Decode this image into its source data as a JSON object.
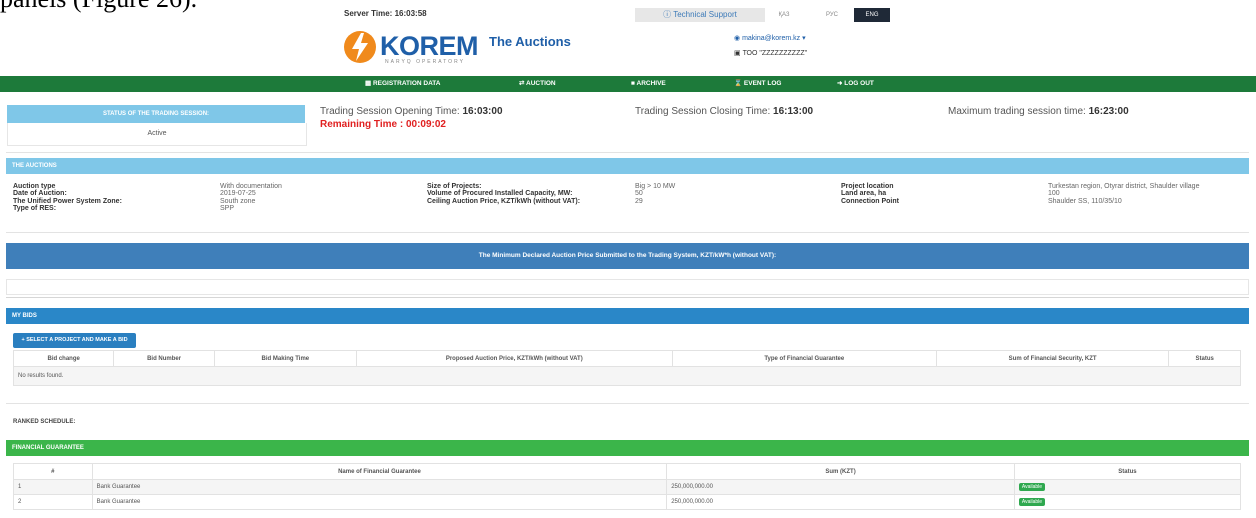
{
  "caption": "panels (Figure 26).",
  "header": {
    "server_time_label": "Server Time:",
    "server_time": "16:03:58",
    "tech_support": "Technical Support",
    "languages": [
      "ҚАЗ",
      "РУС",
      "ENG"
    ],
    "active_language": "ENG",
    "logo_text": "KOREM",
    "logo_sub": "NARYQ OPERATORY",
    "page_title": "The Auctions",
    "user_email": "makina@korem.kz",
    "company": "ТОО \"ZZZZZZZZZZ\""
  },
  "nav": {
    "items": [
      "REGISTRATION DATA",
      "AUCTION",
      "ARCHIVE",
      "EVENT LOG",
      "LOG OUT"
    ]
  },
  "session": {
    "status_heading": "STATUS OF THE TRADING SESSION:",
    "status_value": "Active",
    "opening_label": "Trading Session Opening Time:",
    "opening_time": "16:03:00",
    "closing_label": "Trading Session Closing Time:",
    "closing_time": "16:13:00",
    "max_label": "Maximum trading session time:",
    "max_time": "16:23:00",
    "remaining_label": "Remaining Time :",
    "remaining_time": "00:09:02"
  },
  "auctions": {
    "heading": "THE AUCTIONS",
    "col1_keys": [
      "Auction type",
      "Date of Auction:",
      "The Unified Power System Zone:",
      "Type of RES:"
    ],
    "col1_vals": [
      "With documentation",
      "2019-07-25",
      "South zone",
      "SPP"
    ],
    "col2_keys": [
      "Size of Projects:",
      "Volume of Procured Installed Capacity, MW:",
      "Ceiling Auction Price, KZT/kWh (without VAT):"
    ],
    "col2_vals": [
      "Big > 10 MW",
      "50",
      "29"
    ],
    "col3_keys": [
      "Project location",
      "Land area, ha",
      "Connection Point"
    ],
    "col3_vals": [
      "Turkestan region, Otyrar district, Shaulder village",
      "100",
      "Shaulder SS, 110/35/10"
    ]
  },
  "min_price_bar": "The Minimum Declared Auction Price Submitted to the Trading System, KZT/kW*h (without VAT):",
  "bids": {
    "heading": "MY BIDS",
    "button": "+ SELECT A PROJECT AND MAKE A BID",
    "columns": [
      "Bid change",
      "Bid Number",
      "Bid Making Time",
      "Proposed Auction Price, KZT/kWh (without VAT)",
      "Type of Financial Guarantee",
      "Sum of Financial Security, KZT",
      "Status"
    ],
    "empty": "No results found."
  },
  "ranked_schedule": "RANKED SCHEDULE:",
  "guarantee": {
    "heading": "FINANCIAL GUARANTEE",
    "columns": [
      "#",
      "Name of Financial Guarantee",
      "Sum (KZT)",
      "Status"
    ],
    "rows": [
      {
        "num": "1",
        "name": "Bank Guarantee",
        "sum": "250,000,000.00",
        "status": "Available"
      },
      {
        "num": "2",
        "name": "Bank Guarantee",
        "sum": "250,000,000.00",
        "status": "Available"
      }
    ]
  },
  "colors": {
    "nav": "#1d7a3a",
    "light_blue": "#7fc7e8",
    "blue_bar": "#3f7fba",
    "green_header": "#3bb54a",
    "badge": "#2fa84f"
  }
}
